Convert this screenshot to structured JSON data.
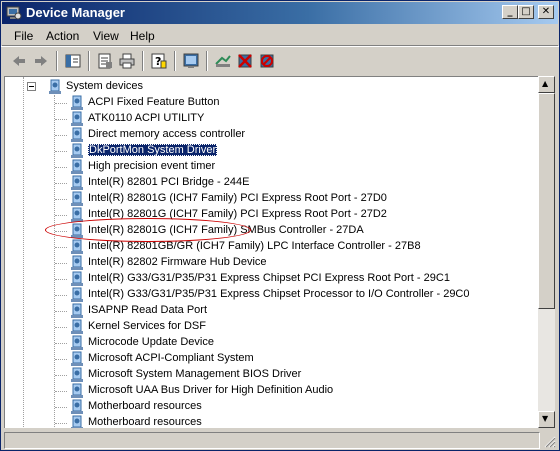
{
  "window": {
    "title": "Device Manager",
    "minimize_glyph": "_",
    "maximize_glyph": "□",
    "close_glyph": "✕"
  },
  "menu": {
    "items": [
      {
        "label": "File"
      },
      {
        "label": "Action"
      },
      {
        "label": "View"
      },
      {
        "label": "Help"
      }
    ]
  },
  "toolbar": {
    "buttons": [
      {
        "icon": "back-icon"
      },
      {
        "icon": "forward-icon"
      },
      {
        "icon": "show-hide-tree-icon"
      },
      {
        "icon": "properties-icon"
      },
      {
        "icon": "print-icon"
      },
      {
        "icon": "help-icon"
      },
      {
        "icon": "scan-hardware-icon"
      },
      {
        "icon": "update-driver-icon"
      },
      {
        "icon": "disable-device-icon"
      },
      {
        "icon": "uninstall-icon"
      }
    ]
  },
  "tree": {
    "category": {
      "label": "System devices",
      "expander": "−",
      "icon": "system-devices-icon"
    },
    "devices": [
      {
        "label": "ACPI Fixed Feature Button"
      },
      {
        "label": "ATK0110 ACPI UTILITY"
      },
      {
        "label": "Direct memory access controller"
      },
      {
        "label": "DkPortMon System Driver",
        "selected": true
      },
      {
        "label": "High precision event timer"
      },
      {
        "label": "Intel(R) 82801 PCI Bridge - 244E"
      },
      {
        "label": "Intel(R) 82801G (ICH7 Family) PCI Express Root Port - 27D0"
      },
      {
        "label": "Intel(R) 82801G (ICH7 Family) PCI Express Root Port - 27D2"
      },
      {
        "label": "Intel(R) 82801G (ICH7 Family) SMBus Controller - 27DA"
      },
      {
        "label": "Intel(R) 82801GB/GR (ICH7 Family) LPC Interface Controller - 27B8"
      },
      {
        "label": "Intel(R) 82802 Firmware Hub Device"
      },
      {
        "label": "Intel(R) G33/G31/P35/P31 Express Chipset PCI Express Root Port - 29C1"
      },
      {
        "label": "Intel(R) G33/G31/P35/P31 Express Chipset Processor to I/O Controller - 29C0"
      },
      {
        "label": "ISAPNP Read Data Port"
      },
      {
        "label": "Kernel Services for DSF"
      },
      {
        "label": "Microcode Update Device"
      },
      {
        "label": "Microsoft ACPI-Compliant System"
      },
      {
        "label": "Microsoft System Management BIOS Driver"
      },
      {
        "label": "Microsoft UAA Bus Driver for High Definition Audio"
      },
      {
        "label": "Motherboard resources"
      },
      {
        "label": "Motherboard resources"
      }
    ]
  },
  "scrollbar": {
    "up_glyph": "▲",
    "down_glyph": "▼"
  },
  "colors": {
    "title_gradient_start": "#0a246a",
    "title_gradient_end": "#a6caf0",
    "selection": "#0a246a",
    "annotation_ellipse": "#cc0000"
  }
}
